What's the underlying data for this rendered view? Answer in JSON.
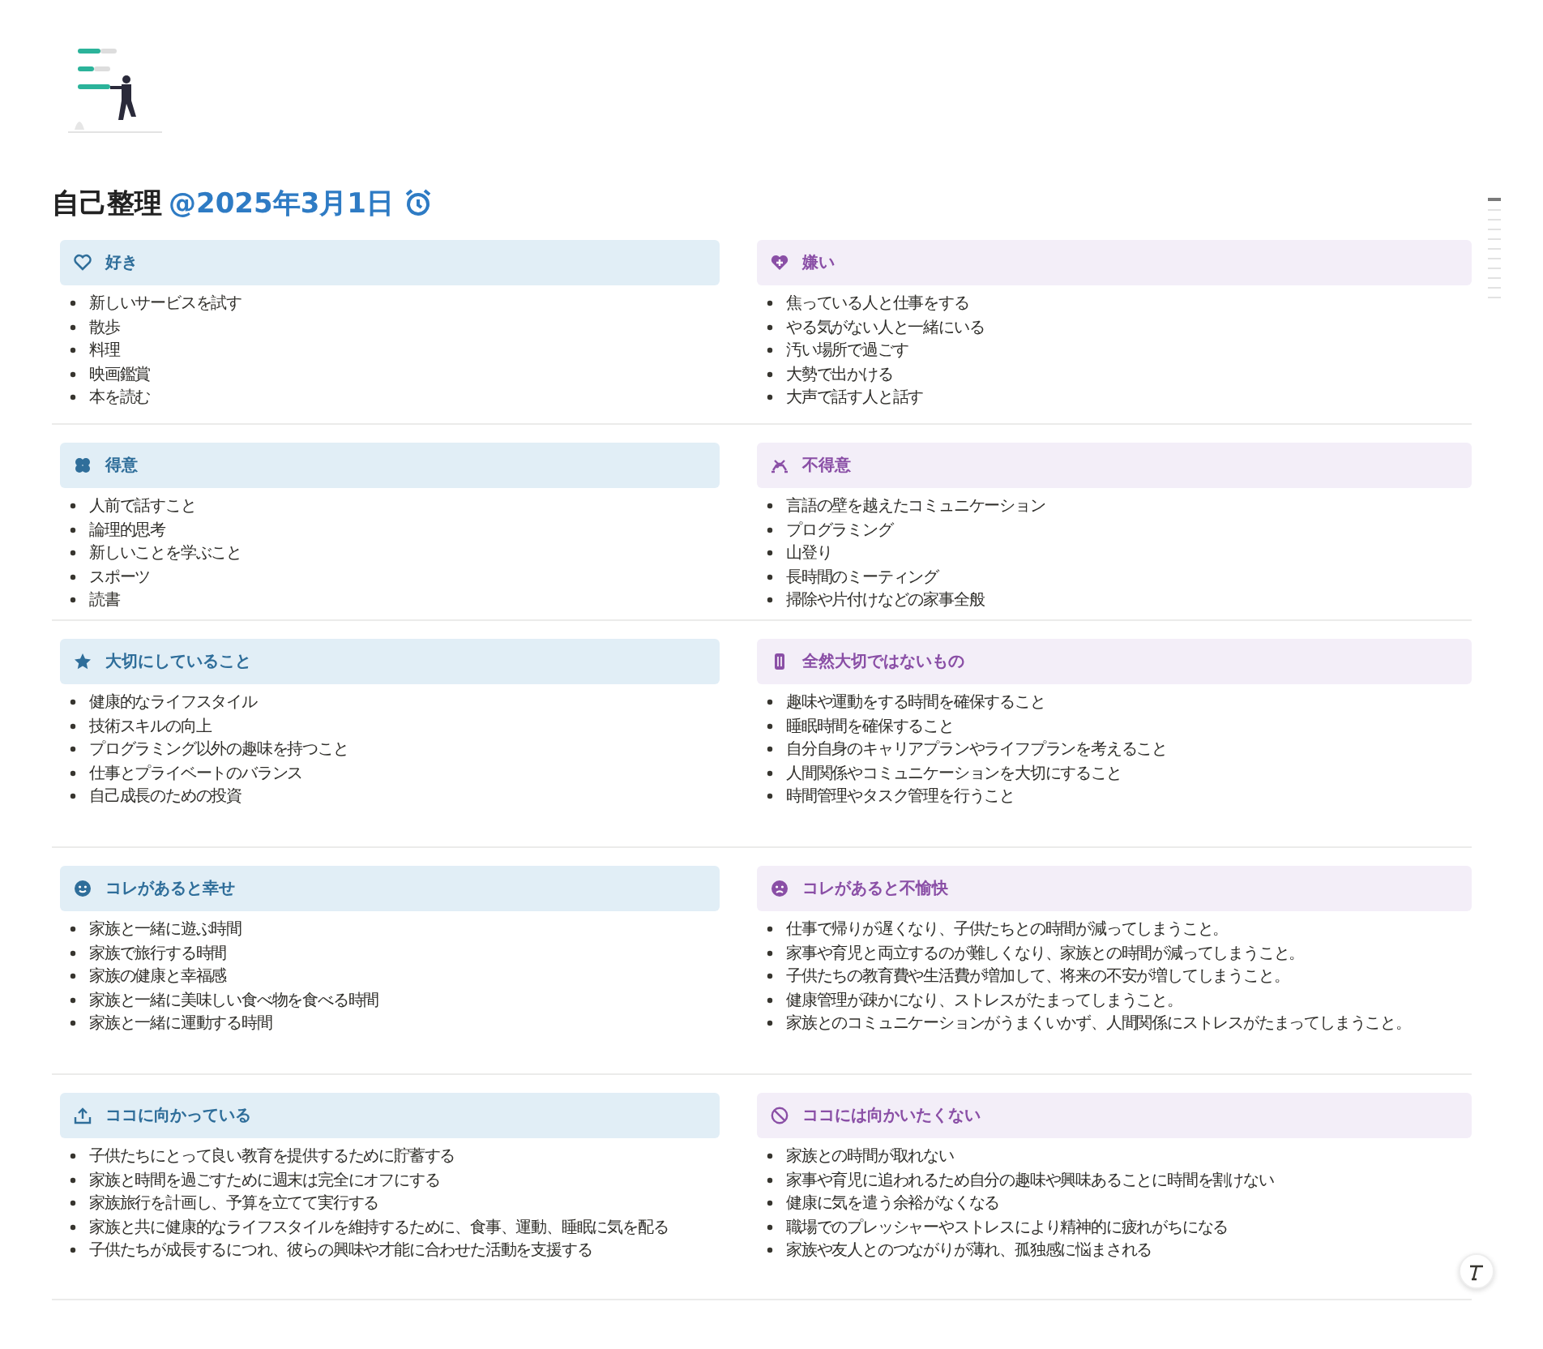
{
  "title": {
    "text": "自己整理",
    "mention": "@2025年3月1日"
  },
  "rows": [
    {
      "cards": [
        {
          "heading": "好き",
          "color": "#2f6e9a",
          "items": [
            "新しいサービスを試す",
            "散歩",
            "料理",
            "映画鑑賞",
            "本を読む"
          ]
        },
        {
          "heading": "嫌い",
          "color": "#8a4fa6",
          "items": [
            "焦っている人と仕事をする",
            "やる気がない人と一緒にいる",
            "汚い場所で過ごす",
            "大勢で出かける",
            "大声で話す人と話す"
          ]
        }
      ]
    },
    {
      "cards": [
        {
          "heading": "得意",
          "color": "#2f6e9a",
          "items": [
            "人前で話すこと",
            "論理的思考",
            "新しいことを学ぶこと",
            "スポーツ",
            "読書"
          ]
        },
        {
          "heading": "不得意",
          "color": "#8a4fa6",
          "items": [
            "言語の壁を越えたコミュニケーション",
            "プログラミング",
            "山登り",
            "長時間のミーティング",
            "掃除や片付けなどの家事全般"
          ]
        }
      ]
    },
    {
      "cards": [
        {
          "heading": "大切にしていること",
          "color": "#2f6e9a",
          "items": [
            "健康的なライフスタイル",
            "技術スキルの向上",
            "プログラミング以外の趣味を持つこと",
            "仕事とプライベートのバランス",
            "自己成長のための投資"
          ]
        },
        {
          "heading": "全然大切ではないもの",
          "color": "#8a4fa6",
          "items": [
            "趣味や運動をする時間を確保すること",
            "睡眠時間を確保すること",
            "自分自身のキャリアプランやライフプランを考えること",
            "人間関係やコミュニケーションを大切にすること",
            "時間管理やタスク管理を行うこと"
          ]
        }
      ]
    },
    {
      "cards": [
        {
          "heading": "コレがあると幸せ",
          "color": "#2f6e9a",
          "items": [
            "家族と一緒に遊ぶ時間",
            "家族で旅行する時間",
            "家族の健康と幸福感",
            "家族と一緒に美味しい食べ物を食べる時間",
            "家族と一緒に運動する時間"
          ]
        },
        {
          "heading": "コレがあると不愉快",
          "color": "#8a4fa6",
          "items": [
            "仕事で帰りが遅くなり、子供たちとの時間が減ってしまうこと。",
            "家事や育児と両立するのが難しくなり、家族との時間が減ってしまうこと。",
            "子供たちの教育費や生活費が増加して、将来の不安が増してしまうこと。",
            "健康管理が疎かになり、ストレスがたまってしまうこと。",
            "家族とのコミュニケーションがうまくいかず、人間関係にストレスがたまってしまうこと。"
          ]
        }
      ]
    },
    {
      "cards": [
        {
          "heading": "ココに向かっている",
          "color": "#2f6e9a",
          "items": [
            "子供たちにとって良い教育を提供するために貯蓄する",
            "家族と時間を過ごすために週末は完全にオフにする",
            "家族旅行を計画し、予算を立てて実行する",
            "家族と共に健康的なライフスタイルを維持するために、食事、運動、睡眠に気を配る",
            "子供たちが成長するにつれ、彼らの興味や才能に合わせた活動を支援する"
          ]
        },
        {
          "heading": "ココには向かいたくない",
          "color": "#8a4fa6",
          "items": [
            "家族との時間が取れない",
            "家事や育児に追われるため自分の趣味や興味あることに時間を割けない",
            "健康に気を遣う余裕がなくなる",
            "職場でのプレッシャーやストレスにより精神的に疲れがちになる",
            "家族や友人とのつながりが薄れ、孤独感に悩まされる"
          ]
        }
      ]
    }
  ]
}
